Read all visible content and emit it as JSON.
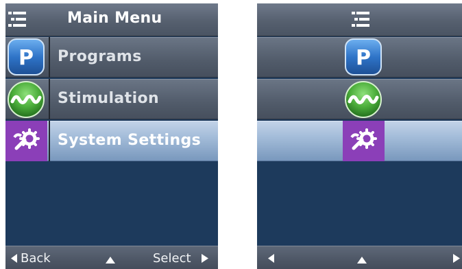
{
  "left_screen": {
    "header": {
      "title": "Main Menu",
      "icon": "menu-list-icon"
    },
    "rows": [
      {
        "label": "Programs",
        "icon": "programs-p-icon",
        "selected": false
      },
      {
        "label": "Stimulation",
        "icon": "stimulation-wave-icon",
        "selected": false
      },
      {
        "label": "System Settings",
        "icon": "system-settings-gear-icon",
        "selected": true
      }
    ],
    "footer": {
      "back_label": "Back",
      "select_label": "Select",
      "back_icon": "arrow-left-icon",
      "up_icon": "arrow-up-icon",
      "select_icon": "arrow-right-icon"
    }
  },
  "right_screen": {
    "header": {
      "icon": "menu-list-icon"
    },
    "rows": [
      {
        "icon": "programs-p-icon",
        "selected": false
      },
      {
        "icon": "stimulation-wave-icon",
        "selected": false
      },
      {
        "icon": "system-settings-gear-icon",
        "selected": true
      }
    ],
    "footer": {
      "back_icon": "arrow-left-icon",
      "up_icon": "arrow-up-icon",
      "select_icon": "arrow-right-icon"
    }
  },
  "icon_letters": {
    "programs": "P"
  },
  "colors": {
    "screen_background": "#1d3a5c",
    "programs_icon": "#2f74c8",
    "stimulation_icon": "#4cae3b",
    "settings_icon": "#8b3fb8",
    "selected_row": "#a3bcd9"
  }
}
